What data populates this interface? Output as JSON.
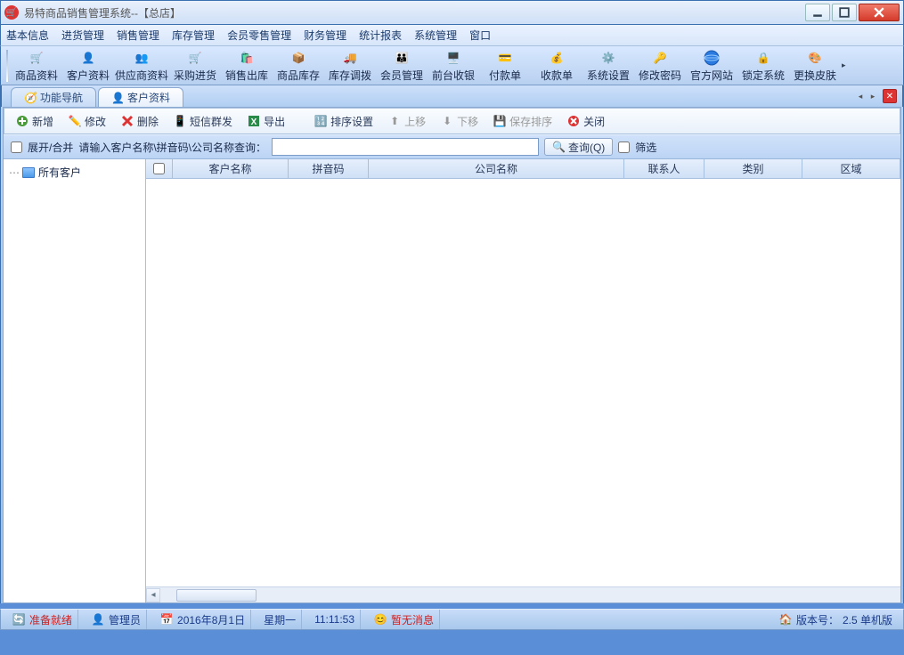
{
  "window": {
    "title": "易特商品销售管理系统--【总店】"
  },
  "menu": [
    "基本信息",
    "进货管理",
    "销售管理",
    "库存管理",
    "会员零售管理",
    "财务管理",
    "统计报表",
    "系统管理",
    "窗口"
  ],
  "toolbar": [
    {
      "id": "product-info",
      "label": "商品资料",
      "icon": "cart"
    },
    {
      "id": "customer-info",
      "label": "客户资料",
      "icon": "user"
    },
    {
      "id": "supplier-info",
      "label": "供应商资料",
      "icon": "users"
    },
    {
      "id": "purchase-in",
      "label": "采购进货",
      "icon": "cartin"
    },
    {
      "id": "sales-out",
      "label": "销售出库",
      "icon": "cartout"
    },
    {
      "id": "stock",
      "label": "商品库存",
      "icon": "box"
    },
    {
      "id": "transfer",
      "label": "库存调拨",
      "icon": "truck"
    },
    {
      "id": "member",
      "label": "会员管理",
      "icon": "members"
    },
    {
      "id": "pos",
      "label": "前台收银",
      "icon": "pos"
    },
    {
      "id": "payment",
      "label": "付款单",
      "icon": "payout"
    },
    {
      "id": "receipt",
      "label": "收款单",
      "icon": "payin"
    },
    {
      "id": "settings",
      "label": "系统设置",
      "icon": "gear"
    },
    {
      "id": "password",
      "label": "修改密码",
      "icon": "key"
    },
    {
      "id": "website",
      "label": "官方网站",
      "icon": "globe"
    },
    {
      "id": "lock",
      "label": "锁定系统",
      "icon": "lock"
    },
    {
      "id": "skin",
      "label": "更换皮肤",
      "icon": "skin"
    }
  ],
  "tabs": [
    {
      "id": "nav",
      "label": "功能导航",
      "active": false
    },
    {
      "id": "customer",
      "label": "客户资料",
      "active": true
    }
  ],
  "subtoolbar": {
    "add": "新增",
    "edit": "修改",
    "delete": "删除",
    "sms": "短信群发",
    "export": "导出",
    "sort": "排序设置",
    "up": "上移",
    "down": "下移",
    "savesort": "保存排序",
    "close": "关闭"
  },
  "search": {
    "expand_label": "展开/合并",
    "prompt": "请输入客户名称\\拼音码\\公司名称查询：",
    "query_value": "",
    "btn": "查询(Q)",
    "filter": "筛选"
  },
  "tree": {
    "root": "所有客户"
  },
  "grid": {
    "columns": [
      "客户名称",
      "拼音码",
      "公司名称",
      "联系人",
      "类别",
      "区域"
    ]
  },
  "status": {
    "ready": "准备就绪",
    "user": "管理员",
    "date": "2016年8月1日",
    "weekday": "星期一",
    "time": "11:11:53",
    "msg": "暂无消息",
    "version_label": "版本号：",
    "version": "2.5 单机版"
  },
  "colors": {
    "accent": "#3a7ac8",
    "danger": "#d43a2a",
    "green": "#3a9a3a"
  }
}
